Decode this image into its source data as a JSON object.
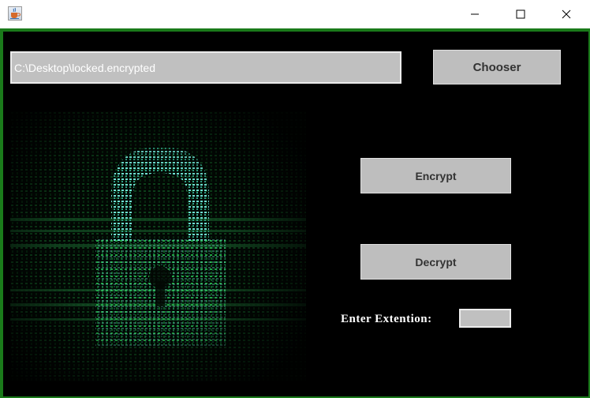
{
  "window": {
    "icon": "java-cup-icon",
    "min_icon": "minimize-icon",
    "max_icon": "maximize-icon",
    "close_icon": "close-icon"
  },
  "file": {
    "path_value": "C:\\Desktop\\locked.encrypted"
  },
  "buttons": {
    "chooser": "Chooser",
    "encrypt": "Encrypt",
    "decrypt": "Decrypt"
  },
  "extension": {
    "label": "Enter Extention:",
    "value": ""
  },
  "image": {
    "subject": "matrix-padlock-graphic"
  },
  "colors": {
    "background": "#000000",
    "frame": "#1a7a1a",
    "button": "#bebebe",
    "field": "#c0c0c0",
    "lock_green": "#2fae4f",
    "lock_cyan": "#5ad3c8"
  }
}
